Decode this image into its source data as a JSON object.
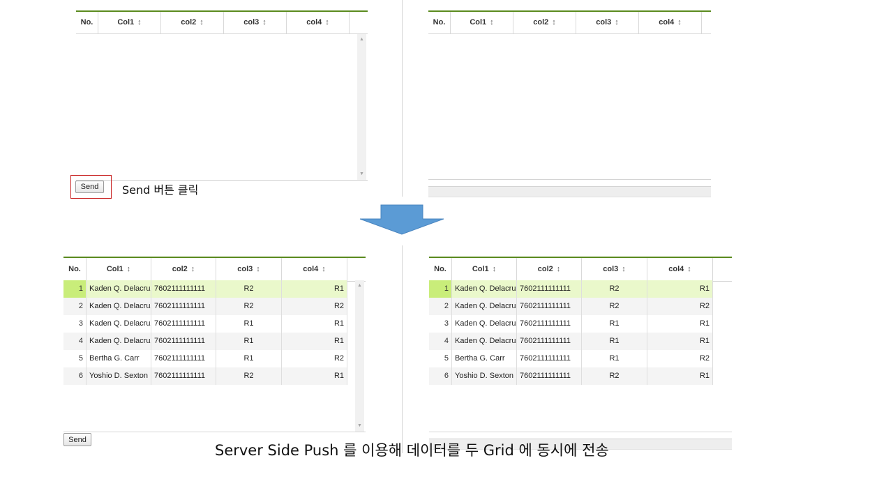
{
  "columns": [
    {
      "label": "No.",
      "sortable": false
    },
    {
      "label": "Col1",
      "sortable": true
    },
    {
      "label": "col2",
      "sortable": true
    },
    {
      "label": "col3",
      "sortable": true
    },
    {
      "label": "col4",
      "sortable": true
    }
  ],
  "sort_glyph": "↕",
  "scroll_up_glyph": "▲",
  "scroll_down_glyph": "▼",
  "send_label": "Send",
  "step1_caption": "Send 버튼 클릭",
  "step2_caption": "Server Side Push 를 이용해 데이터를 두 Grid 에 동시에 전송",
  "rows": [
    {
      "no": "1",
      "col1": "Kaden Q. Delacruz",
      "col2": "7602111111111",
      "col3": "R2",
      "col4": "R1"
    },
    {
      "no": "2",
      "col1": "Kaden Q. Delacruz",
      "col2": "7602111111111",
      "col3": "R2",
      "col4": "R2"
    },
    {
      "no": "3",
      "col1": "Kaden Q. Delacruz",
      "col2": "7602111111111",
      "col3": "R1",
      "col4": "R1"
    },
    {
      "no": "4",
      "col1": "Kaden Q. Delacruz",
      "col2": "7602111111111",
      "col3": "R1",
      "col4": "R1"
    },
    {
      "no": "5",
      "col1": "Bertha G. Carr",
      "col2": "7602111111111",
      "col3": "R1",
      "col4": "R2"
    },
    {
      "no": "6",
      "col1": "Yoshio D. Sexton",
      "col2": "7602111111111",
      "col3": "R2",
      "col4": "R1"
    }
  ],
  "selected_row": "1",
  "colors": {
    "header_accent": "#5a8a1e",
    "selected_row": "#eaf8cb",
    "selected_num": "#c9ed7a",
    "arrow": "#5b9bd5",
    "highlight_border": "#c81e1e"
  }
}
